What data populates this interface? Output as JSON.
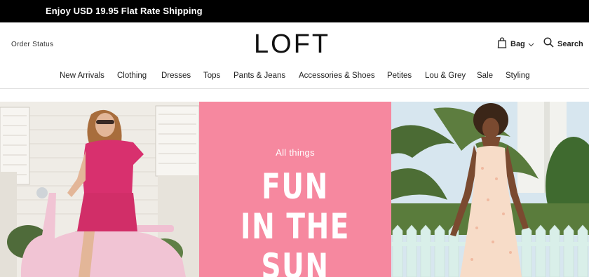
{
  "promo": {
    "text": "Enjoy USD 19.95 Flat Rate Shipping"
  },
  "header": {
    "order_status": "Order Status",
    "logo": "LOFT",
    "bag_label": "Bag",
    "search_label": "Search"
  },
  "nav": {
    "items": [
      {
        "label": "New Arrivals"
      },
      {
        "label": "Clothing"
      },
      {
        "label": "Dresses"
      },
      {
        "label": "Tops"
      },
      {
        "label": "Pants & Jeans"
      },
      {
        "label": "Accessories & Shoes"
      },
      {
        "label": "Petites"
      },
      {
        "label": "Lou & Grey"
      },
      {
        "label": "Sale"
      },
      {
        "label": "Styling"
      }
    ]
  },
  "hero": {
    "eyebrow": "All things",
    "line1": "FUN",
    "line2": "IN THE",
    "line3": "SUN",
    "accent_color": "#f6889f"
  }
}
